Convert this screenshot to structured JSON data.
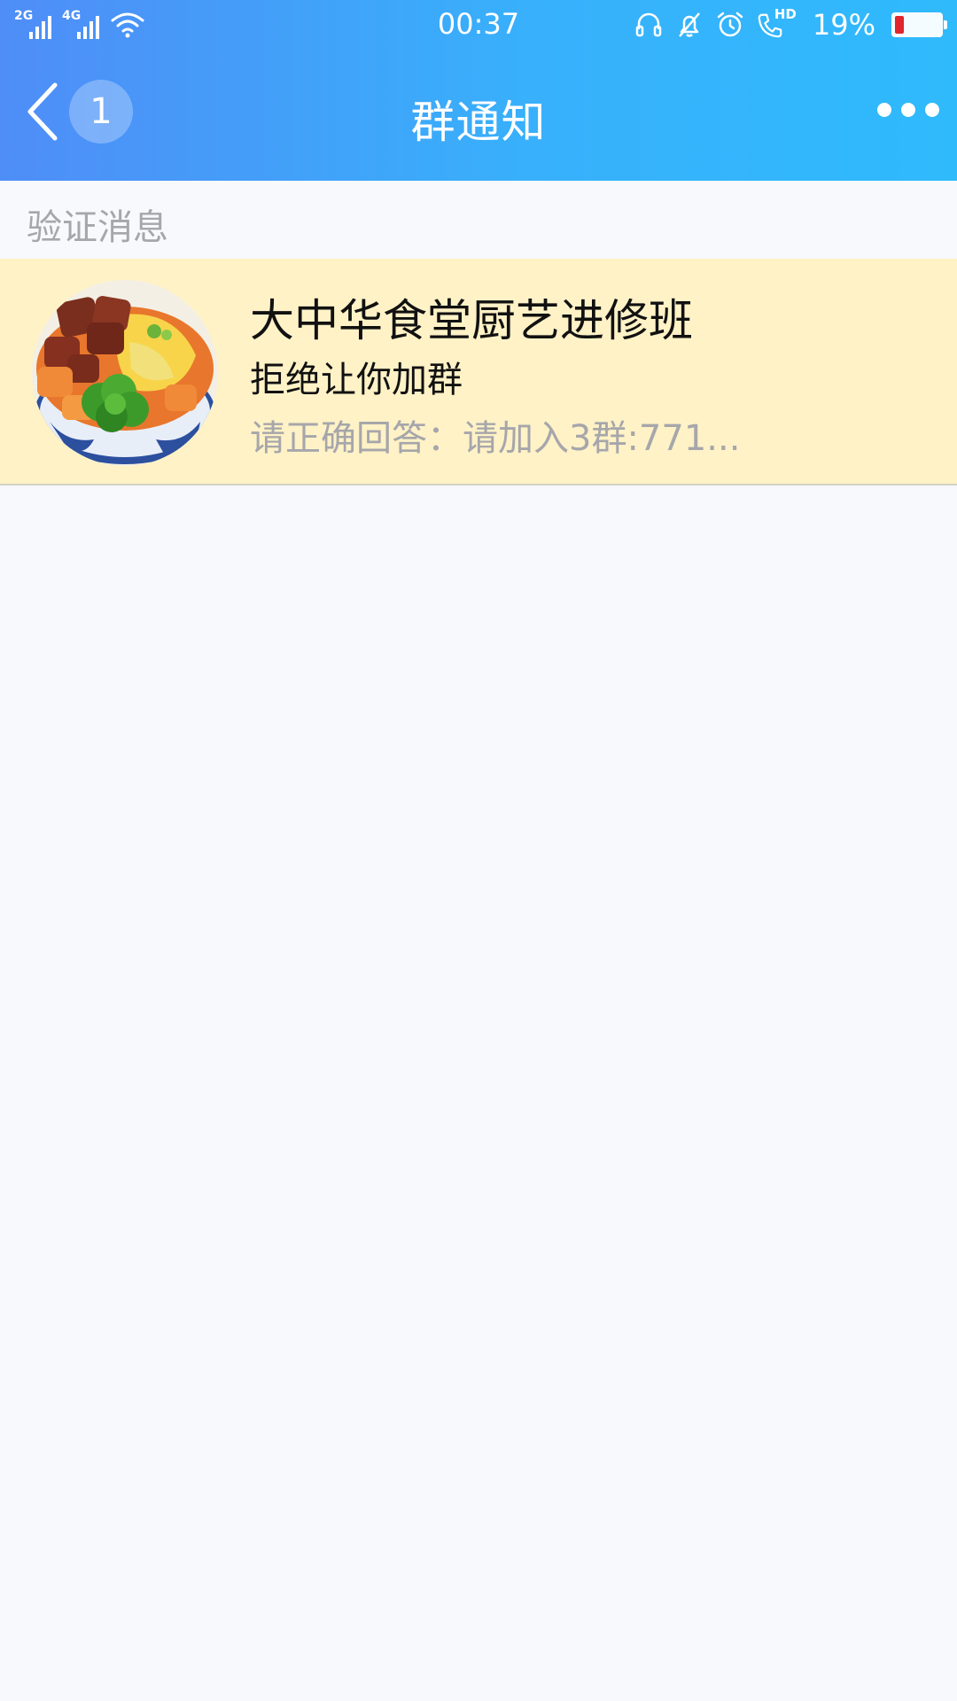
{
  "status_bar": {
    "signal_1_label": "2G",
    "signal_2_label": "4G",
    "time": "00:37",
    "hd_label": "HD",
    "battery_percent_text": "19%",
    "battery_level": 0.19,
    "icons": [
      "signal-icon",
      "signal-icon",
      "wifi-icon",
      "headset-icon",
      "bell-off-icon",
      "alarm-icon",
      "hd-call-icon",
      "battery-icon"
    ]
  },
  "nav": {
    "back_icon": "chevron-left-icon",
    "unread_count": "1",
    "title": "群通知",
    "more_icon": "more-dots-icon"
  },
  "section": {
    "title": "验证消息"
  },
  "notifications": [
    {
      "group_name": "大中华食堂厨艺进修班",
      "status": "拒绝让你加群",
      "message": "请正确回答：请加入3群:771..."
    }
  ],
  "colors": {
    "header_start": "#4f8df7",
    "header_end": "#2fbafc",
    "highlight_bg": "#fef2c6",
    "battery_low": "#e0262c"
  }
}
